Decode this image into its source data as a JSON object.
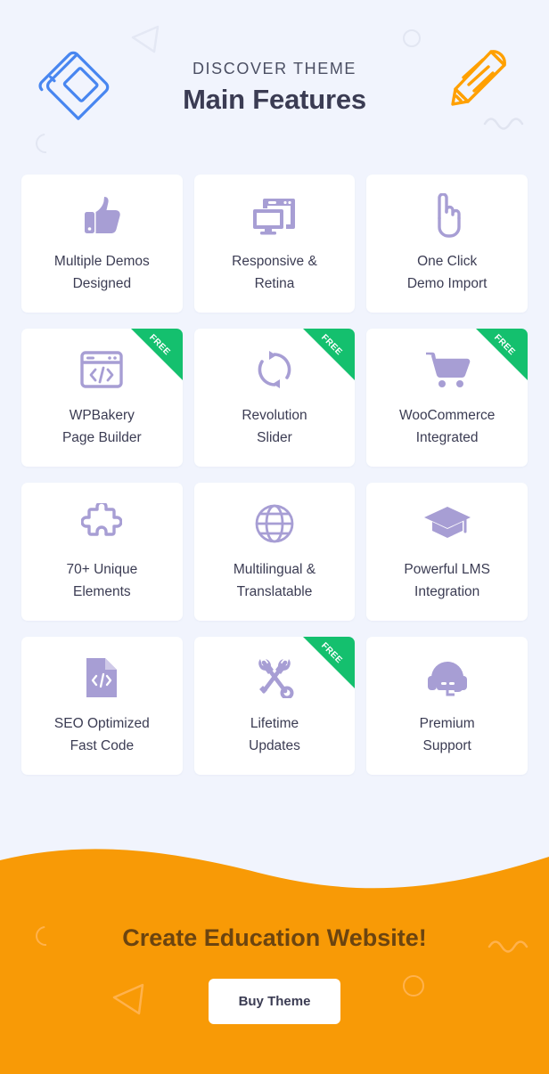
{
  "header": {
    "eyebrow": "DISCOVER THEME",
    "title": "Main Features",
    "left_icon": "book-icon",
    "right_icon": "pencil-icon",
    "left_icon_color": "#4886f0",
    "right_icon_color": "#ffa000",
    "deco": [
      "triangle-outline",
      "circle-outline",
      "arc-outline",
      "squiggle"
    ]
  },
  "theme": {
    "page_background": "#f1f4fd",
    "card_background": "#ffffff",
    "icon_color": "#a79ed4",
    "title_color": "#3b3c53",
    "ribbon_color": "#14c06e",
    "cta_background": "#f89a06",
    "cta_title_color": "#6b4410"
  },
  "features": [
    {
      "label": "Multiple Demos\nDesigned",
      "icon": "thumbs-up-icon",
      "free": false
    },
    {
      "label": "Responsive &\nRetina",
      "icon": "responsive-icon",
      "free": false
    },
    {
      "label": "One Click\nDemo Import",
      "icon": "pointing-hand-icon",
      "free": false
    },
    {
      "label": "WPBakery\nPage Builder",
      "icon": "code-window-icon",
      "free": true,
      "badge": "FREE"
    },
    {
      "label": "Revolution\nSlider",
      "icon": "refresh-icon",
      "free": true,
      "badge": "FREE"
    },
    {
      "label": "WooCommerce\nIntegrated",
      "icon": "shopping-cart-icon",
      "free": true,
      "badge": "FREE"
    },
    {
      "label": "70+ Unique\nElements",
      "icon": "puzzle-piece-icon",
      "free": false
    },
    {
      "label": "Multilingual &\nTranslatable",
      "icon": "globe-icon",
      "free": false
    },
    {
      "label": "Powerful LMS\nIntegration",
      "icon": "graduation-cap-icon",
      "free": false
    },
    {
      "label": "SEO Optimized\nFast Code",
      "icon": "code-file-icon",
      "free": false
    },
    {
      "label": "Lifetime\nUpdates",
      "icon": "tools-icon",
      "free": true,
      "badge": "FREE"
    },
    {
      "label": "Premium\nSupport",
      "icon": "headset-icon",
      "free": false
    }
  ],
  "cta": {
    "title": "Create Education Website!",
    "button_label": "Buy Theme",
    "deco": [
      "arc-outline",
      "triangle-outline",
      "circle-outline",
      "squiggle"
    ]
  }
}
